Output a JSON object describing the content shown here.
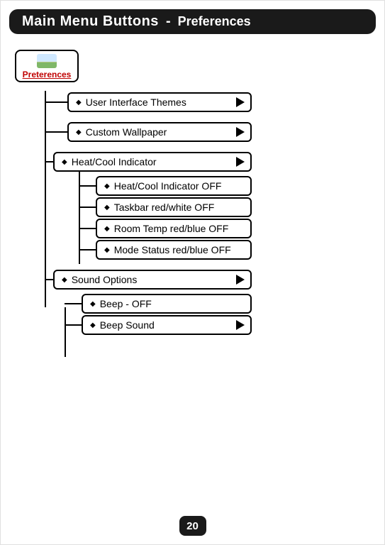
{
  "header": {
    "title": "Main Menu Buttons",
    "separator": "-",
    "subtitle": "Preferences"
  },
  "root": {
    "label": "Preterences"
  },
  "items": {
    "ui_themes": "User Interface Themes",
    "wallpaper": "Custom Wallpaper",
    "heatcool": "Heat/Cool Indicator",
    "hc_off": "Heat/Cool Indicator OFF",
    "taskbar": "Taskbar red/white OFF",
    "roomtemp": "Room Temp red/blue OFF",
    "modestatus": "Mode Status red/blue OFF",
    "sound": "Sound Options",
    "beep_off": "Beep - OFF",
    "beep_sound": "Beep Sound"
  },
  "page_number": "20"
}
